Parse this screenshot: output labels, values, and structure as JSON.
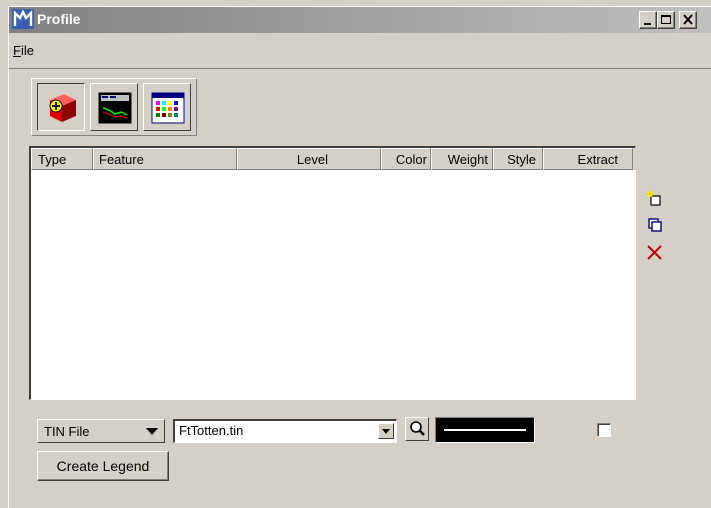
{
  "window": {
    "title": "Profile",
    "controls": {
      "minimize": "_",
      "maximize": "□",
      "close": "X"
    }
  },
  "menubar": {
    "file": {
      "prefix": "F",
      "rest": "ile"
    }
  },
  "toolbar": {
    "tools": [
      {
        "icon": "cube-add-icon",
        "pressed": true
      },
      {
        "icon": "profile-window-icon",
        "pressed": false
      },
      {
        "icon": "color-palette-icon",
        "pressed": false
      }
    ]
  },
  "table": {
    "columns": [
      "Type",
      "Feature",
      "Level",
      "Color",
      "Weight",
      "Style",
      "Extract"
    ],
    "rows": []
  },
  "side_buttons": [
    {
      "icon": "new-item-icon"
    },
    {
      "icon": "copy-icon"
    },
    {
      "icon": "delete-x-icon"
    }
  ],
  "controls": {
    "source_type": "TIN File",
    "file_name": "FtTotten.tin",
    "extract_checked": false,
    "create_legend": "Create Legend"
  },
  "colors": {
    "face": "#d4d0c8",
    "titlebar_start": "#808080",
    "titlebar_end": "#c0c0c0",
    "delete_red": "#c00000",
    "copy_blue": "#000080"
  }
}
